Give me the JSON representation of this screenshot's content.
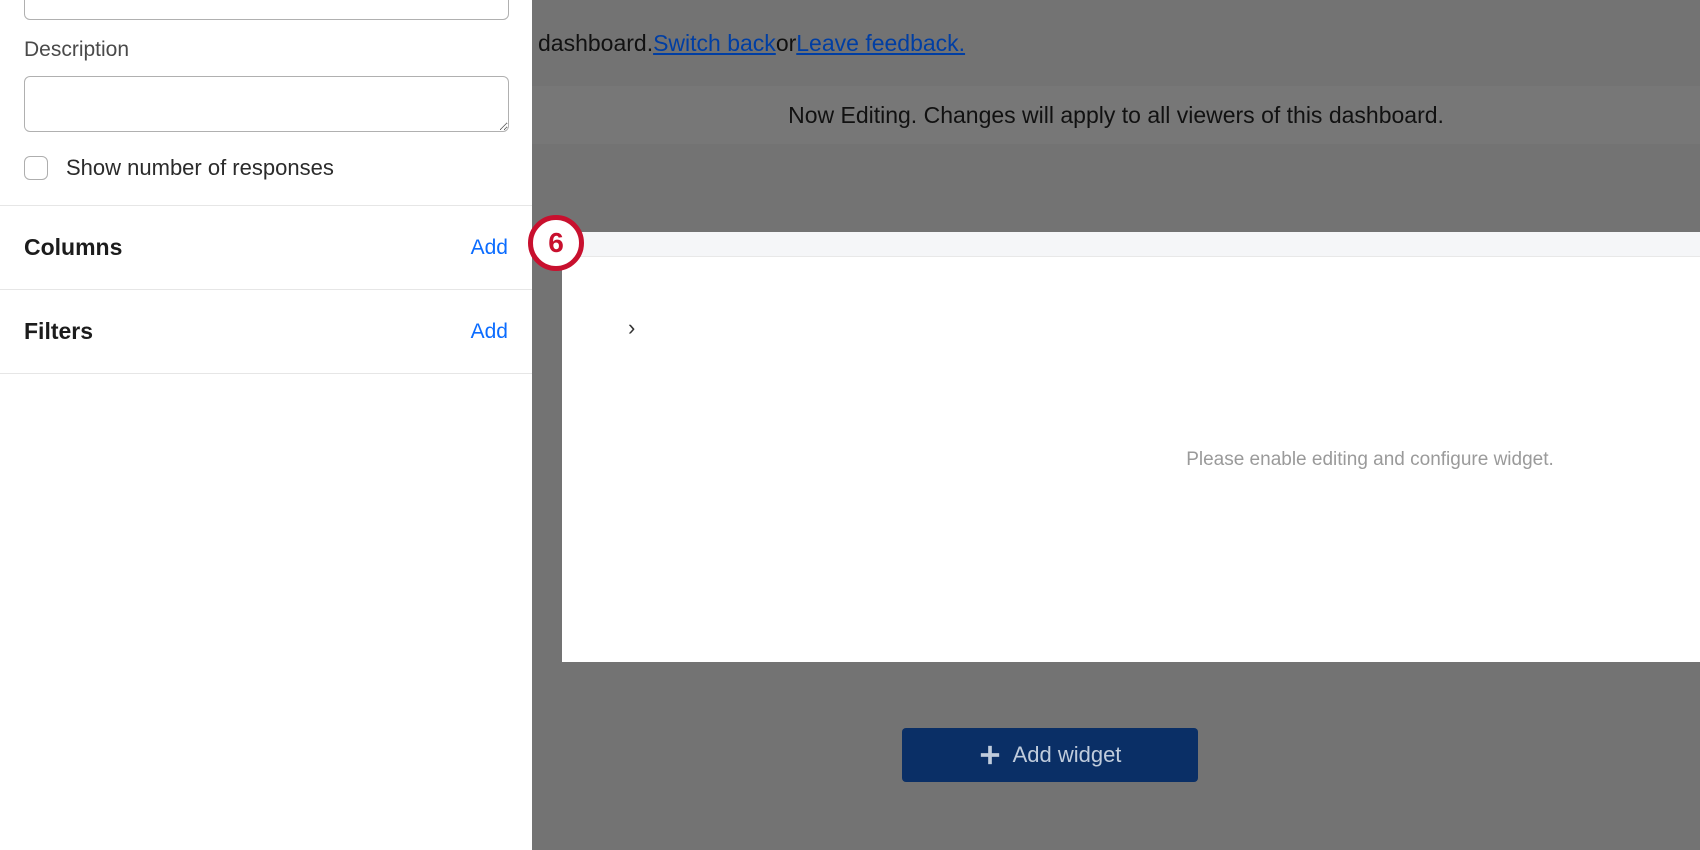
{
  "sidebar": {
    "description_label": "Description",
    "show_responses_label": "Show number of responses",
    "columns_title": "Columns",
    "columns_add": "Add",
    "filters_title": "Filters",
    "filters_add": "Add"
  },
  "overlay": {
    "top_text_prefix": "dashboard. ",
    "switch_back": "Switch back",
    "or_text": " or ",
    "leave_feedback": "Leave feedback.",
    "editing_notice": "Now Editing. Changes will apply to all viewers of this dashboard.",
    "widget_placeholder": "Please enable editing and configure widget.",
    "add_widget_label": "Add widget"
  },
  "step_marker": "6"
}
